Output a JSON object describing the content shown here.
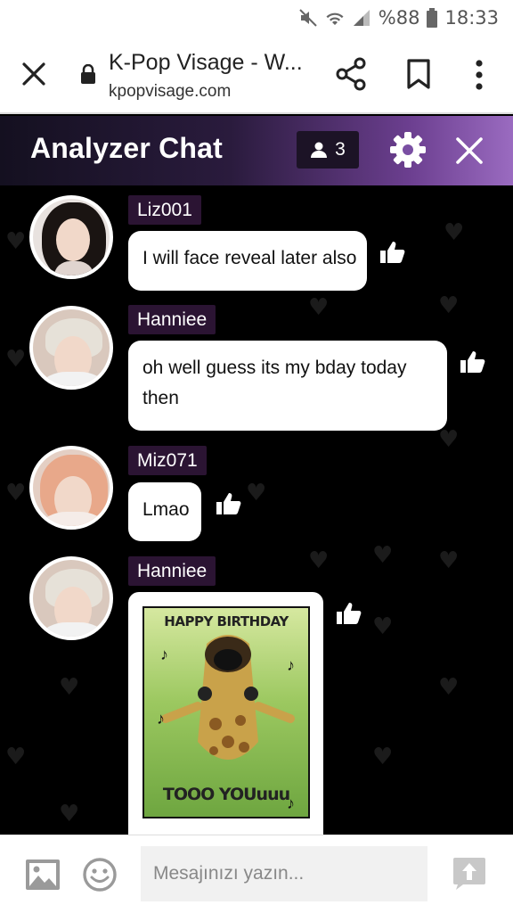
{
  "status_bar": {
    "battery": "%88",
    "time": "18:33"
  },
  "browser": {
    "page_title": "K-Pop Visage - W...",
    "url": "kpopvisage.com"
  },
  "chat_header": {
    "title": "Analyzer Chat",
    "user_count": "3"
  },
  "messages": [
    {
      "username": "Liz001",
      "text": "I will face reveal later also"
    },
    {
      "username": "Hanniee",
      "text": "oh well guess its my bday today then"
    },
    {
      "username": "Miz071",
      "text": "Lmao"
    },
    {
      "username": "Hanniee",
      "image_text_top": "HAPPY BIRTHDAY",
      "image_text_bottom": "TOOO YOUuuu"
    }
  ],
  "input": {
    "placeholder": "Mesajınızı yazın..."
  },
  "colors": {
    "header_accent": "#9a6bc0",
    "username_bg": "#2b1433",
    "background": "#000000"
  }
}
